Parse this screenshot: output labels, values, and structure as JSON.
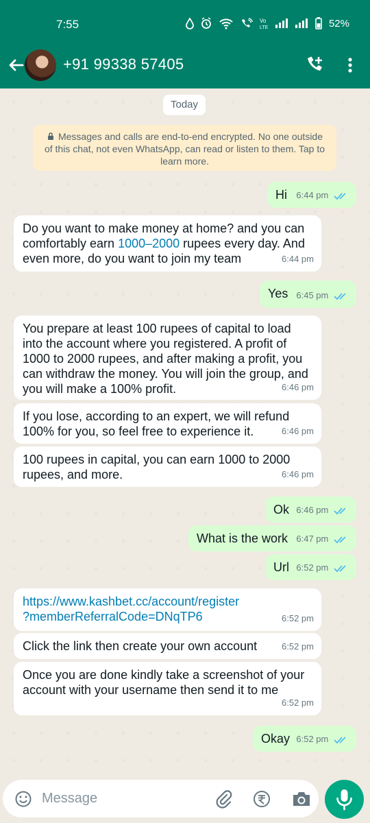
{
  "status_bar": {
    "time": "7:55",
    "battery": "52%"
  },
  "header": {
    "contact_name": "+91 99338 57405"
  },
  "chat": {
    "date_chip": "Today",
    "system_note": "Messages and calls are end-to-end encrypted. No one outside of this chat, not even WhatsApp, can read or listen to them. Tap to learn more.",
    "messages": [
      {
        "text": "Hi",
        "time": "6:44 pm"
      },
      {
        "before_link": "Do you want to make money at home? and you can comfortably earn ",
        "link": "1000–2000",
        "after_link": " rupees every day. And even more, do you want to join my team",
        "time": "6:44 pm"
      },
      {
        "text": "Yes",
        "time": "6:45 pm"
      },
      {
        "text": "You prepare at least 100 rupees of capital to load into the account where you registered. A profit of 1000 to 2000 rupees, and after making a profit, you can withdraw the money. You will join the group, and you will make a 100% profit.",
        "time": "6:46 pm"
      },
      {
        "text": "If you lose, according to an expert, we will refund 100% for you, so feel free to experience it.",
        "time": "6:46 pm"
      },
      {
        "text": "100 rupees in capital, you can earn 1000 to 2000 rupees, and more.",
        "time": "6:46 pm"
      },
      {
        "text": "Ok",
        "time": "6:46 pm"
      },
      {
        "text": "What is the work",
        "time": "6:47 pm"
      },
      {
        "text": "Url",
        "time": "6:52 pm"
      },
      {
        "link": "https://www.kashbet.cc/account/register\n?memberReferralCode=DNqTP6",
        "time": "6:52 pm"
      },
      {
        "text": "Click the link then create your own account",
        "time": "6:52 pm"
      },
      {
        "text": "Once you are done kindly take a screenshot of your account with your username then send it to me",
        "time": "6:52 pm"
      },
      {
        "text": "Okay",
        "time": "6:52 pm"
      }
    ]
  },
  "composer": {
    "placeholder": "Message"
  },
  "colors": {
    "header": "#008069",
    "incoming": "#ffffff",
    "outgoing": "#d9fdd3",
    "link": "#027eb5",
    "read_ticks": "#53bdeb"
  }
}
